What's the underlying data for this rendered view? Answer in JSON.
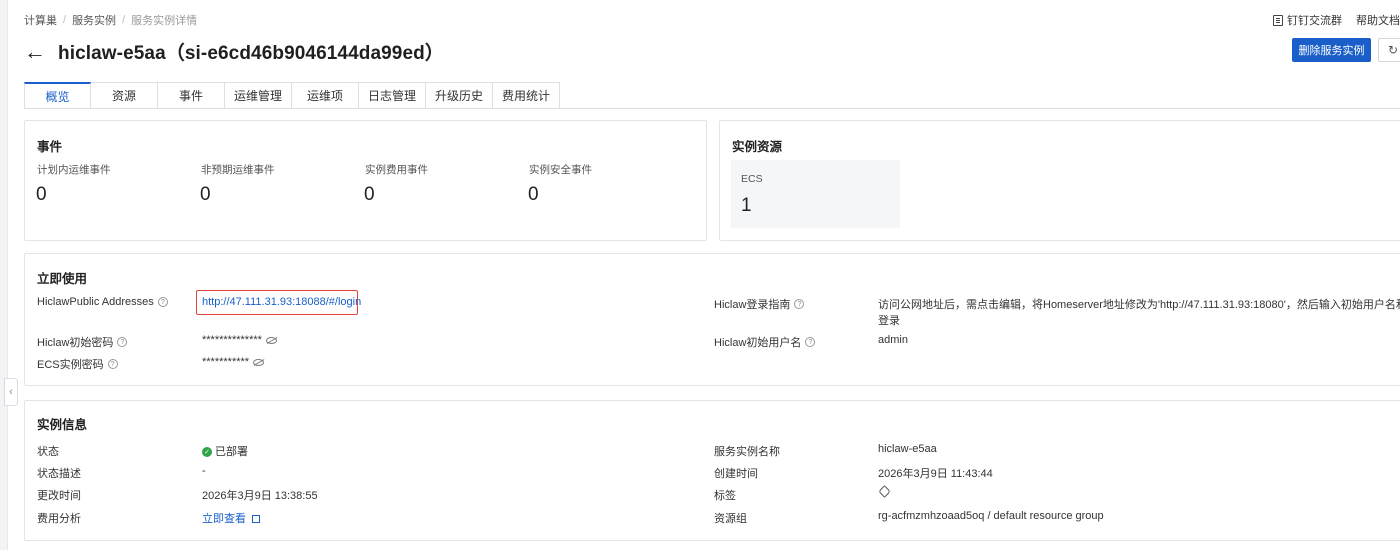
{
  "breadcrumb": {
    "items": [
      "计算巢",
      "服务实例",
      "服务实例详情"
    ]
  },
  "top_links": {
    "dingtalk": "钉钉交流群",
    "help": "帮助文档"
  },
  "header": {
    "back_icon": "arrow-left-icon",
    "title": "hiclaw-e5aa（si-e6cd46b9046144da99ed）",
    "delete_button": "删除服务实例",
    "refresh_icon": "refresh-icon"
  },
  "tabs": [
    {
      "label": "概览",
      "active": true
    },
    {
      "label": "资源",
      "active": false
    },
    {
      "label": "事件",
      "active": false
    },
    {
      "label": "运维管理",
      "active": false
    },
    {
      "label": "运维项",
      "active": false
    },
    {
      "label": "日志管理",
      "active": false
    },
    {
      "label": "升级历史",
      "active": false
    },
    {
      "label": "费用统计",
      "active": false
    }
  ],
  "events": {
    "title": "事件",
    "metrics": [
      {
        "label": "计划内运维事件",
        "value": "0"
      },
      {
        "label": "非预期运维事件",
        "value": "0"
      },
      {
        "label": "实例费用事件",
        "value": "0"
      },
      {
        "label": "实例安全事件",
        "value": "0"
      }
    ]
  },
  "resources": {
    "title": "实例资源",
    "ecs_label": "ECS",
    "ecs_value": "1"
  },
  "quick_use": {
    "title": "立即使用",
    "public_addresses_label": "HiclawPublic Addresses",
    "public_addresses_value": "http://47.111.31.93:18088/#/login",
    "init_password_label": "Hiclaw初始密码",
    "init_password_value": "**************",
    "ecs_password_label": "ECS实例密码",
    "ecs_password_value": "***********",
    "login_guide_label": "Hiclaw登录指南",
    "login_guide_value_line1": "访问公网地址后，需点击编辑，将Homeserver地址修改为'http://47.111.31.93:18080'，然后输入初始用户名和密码即可",
    "login_guide_value_line2": "登录",
    "init_user_label": "Hiclaw初始用户名",
    "init_user_value": "admin"
  },
  "instance_info": {
    "title": "实例信息",
    "status_label": "状态",
    "status_value": "已部署",
    "status_color": "#2fa44a",
    "status_desc_label": "状态描述",
    "status_desc_value": "-",
    "update_time_label": "更改时间",
    "update_time_value": "2026年3月9日 13:38:55",
    "cost_label": "费用分析",
    "cost_value": "立即查看",
    "name_label": "服务实例名称",
    "name_value": "hiclaw-e5aa",
    "create_time_label": "创建时间",
    "create_time_value": "2026年3月9日 11:43:44",
    "tag_label": "标签",
    "resource_group_label": "资源组",
    "resource_group_value": "rg-acfmzmhzoaad5oq / default resource group"
  },
  "colors": {
    "primary": "#1a5fc9",
    "highlight_border": "#e0443c"
  }
}
